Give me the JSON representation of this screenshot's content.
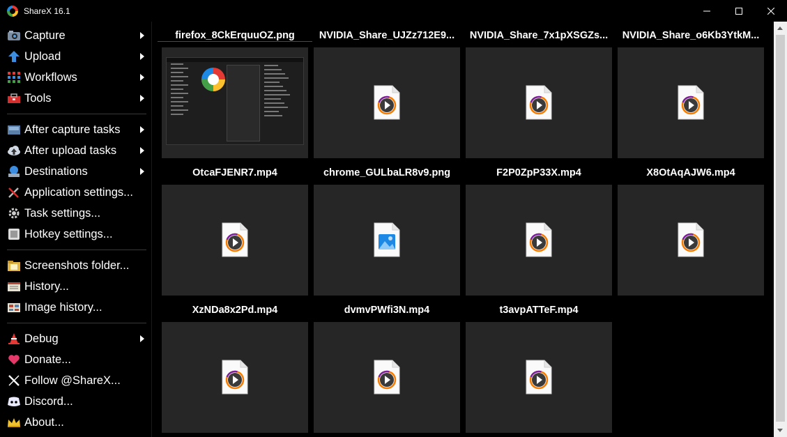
{
  "window": {
    "title": "ShareX 16.1"
  },
  "menu": [
    {
      "label": "Capture",
      "icon": "camera-icon",
      "submenu": true
    },
    {
      "label": "Upload",
      "icon": "upload-arrow-icon",
      "submenu": true
    },
    {
      "label": "Workflows",
      "icon": "workflows-grid-icon",
      "submenu": true
    },
    {
      "label": "Tools",
      "icon": "toolbox-icon",
      "submenu": true
    },
    {
      "label": "After capture tasks",
      "icon": "after-capture-icon",
      "submenu": true
    },
    {
      "label": "After upload tasks",
      "icon": "cloud-upload-icon",
      "submenu": true
    },
    {
      "label": "Destinations",
      "icon": "destinations-icon",
      "submenu": true
    },
    {
      "label": "Application settings...",
      "icon": "wrench-screwdriver-icon",
      "submenu": false
    },
    {
      "label": "Task settings...",
      "icon": "gear-icon",
      "submenu": false
    },
    {
      "label": "Hotkey settings...",
      "icon": "keyboard-icon",
      "submenu": false
    },
    {
      "label": "Screenshots folder...",
      "icon": "folder-icon",
      "submenu": false
    },
    {
      "label": "History...",
      "icon": "history-icon",
      "submenu": false
    },
    {
      "label": "Image history...",
      "icon": "image-history-icon",
      "submenu": false
    },
    {
      "label": "Debug",
      "icon": "traffic-cone-icon",
      "submenu": true
    },
    {
      "label": "Donate...",
      "icon": "heart-icon",
      "submenu": false
    },
    {
      "label": "Follow @ShareX...",
      "icon": "x-logo-icon",
      "submenu": false
    },
    {
      "label": "Discord...",
      "icon": "discord-icon",
      "submenu": false
    },
    {
      "label": "About...",
      "icon": "crown-icon",
      "submenu": false
    }
  ],
  "files": [
    {
      "name": "firefox_8CkErquuOZ.png",
      "type": "screenshot"
    },
    {
      "name": "NVIDIA_Share_UJZz712E9...",
      "type": "video"
    },
    {
      "name": "NVIDIA_Share_7x1pXSGZs...",
      "type": "video"
    },
    {
      "name": "NVIDIA_Share_o6Kb3YtkM...",
      "type": "video"
    },
    {
      "name": "OtcaFJENR7.mp4",
      "type": "video"
    },
    {
      "name": "chrome_GULbaLR8v9.png",
      "type": "image"
    },
    {
      "name": "F2P0ZpP33X.mp4",
      "type": "video"
    },
    {
      "name": "X8OtAqAJW6.mp4",
      "type": "video"
    },
    {
      "name": "XzNDa8x2Pd.mp4",
      "type": "video"
    },
    {
      "name": "dvmvPWfi3N.mp4",
      "type": "video"
    },
    {
      "name": "t3avpATTeF.mp4",
      "type": "video"
    }
  ],
  "colors": {
    "background": "#000000",
    "thumbnail_bg": "#262626",
    "scrollbar_bg": "#f0f0f0",
    "accent_red": "#e53935"
  }
}
